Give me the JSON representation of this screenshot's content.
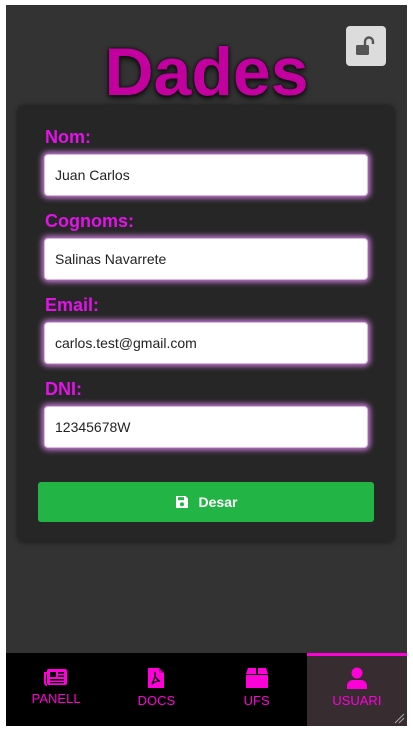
{
  "header": {
    "title": "Dades",
    "lock_icon": "unlock-icon"
  },
  "form": {
    "fields": [
      {
        "label": "Nom:",
        "value": "Juan Carlos"
      },
      {
        "label": "Cognoms:",
        "value": "Salinas Navarrete"
      },
      {
        "label": "Email:",
        "value": "carlos.test@gmail.com"
      },
      {
        "label": "DNI:",
        "value": "12345678W"
      }
    ],
    "save_label": "Desar",
    "save_icon": "floppy-disk-icon"
  },
  "nav": {
    "items": [
      {
        "label": "PANELL",
        "icon": "newspaper-icon",
        "active": false
      },
      {
        "label": "DOCS",
        "icon": "pdf-file-icon",
        "active": false
      },
      {
        "label": "UFS",
        "icon": "box-icon",
        "active": false
      },
      {
        "label": "USUARI",
        "icon": "user-icon",
        "active": true
      }
    ]
  },
  "colors": {
    "accent": "#e014e6",
    "title": "#c3009f",
    "save_button": "#22b545",
    "nav_active_bg": "#372d31",
    "background": "#333333",
    "card": "#262626"
  }
}
